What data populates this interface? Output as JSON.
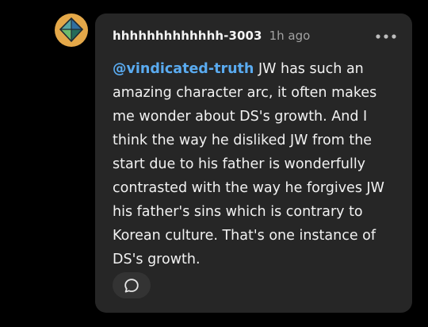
{
  "comment": {
    "username": "hhhhhhhhhhhhh-3003",
    "timestamp": "1h ago",
    "mention": "@vindicated-truth",
    "body": " JW has such an amazing character arc, it often makes me wonder about DS's growth. And I think the way he disliked JW from the start due to his father is wonderfully contrasted with the way he forgives JW his father's sins which is contrary to Korean culture. That's one instance of DS's growth.",
    "avatar_icon": "diamond-avatar-icon",
    "more_icon": "more-dots-icon",
    "reply_icon": "speech-bubble-icon"
  },
  "colors": {
    "card_bg": "#262626",
    "mention": "#5aabf0",
    "avatar_bg": "#e4a849"
  }
}
